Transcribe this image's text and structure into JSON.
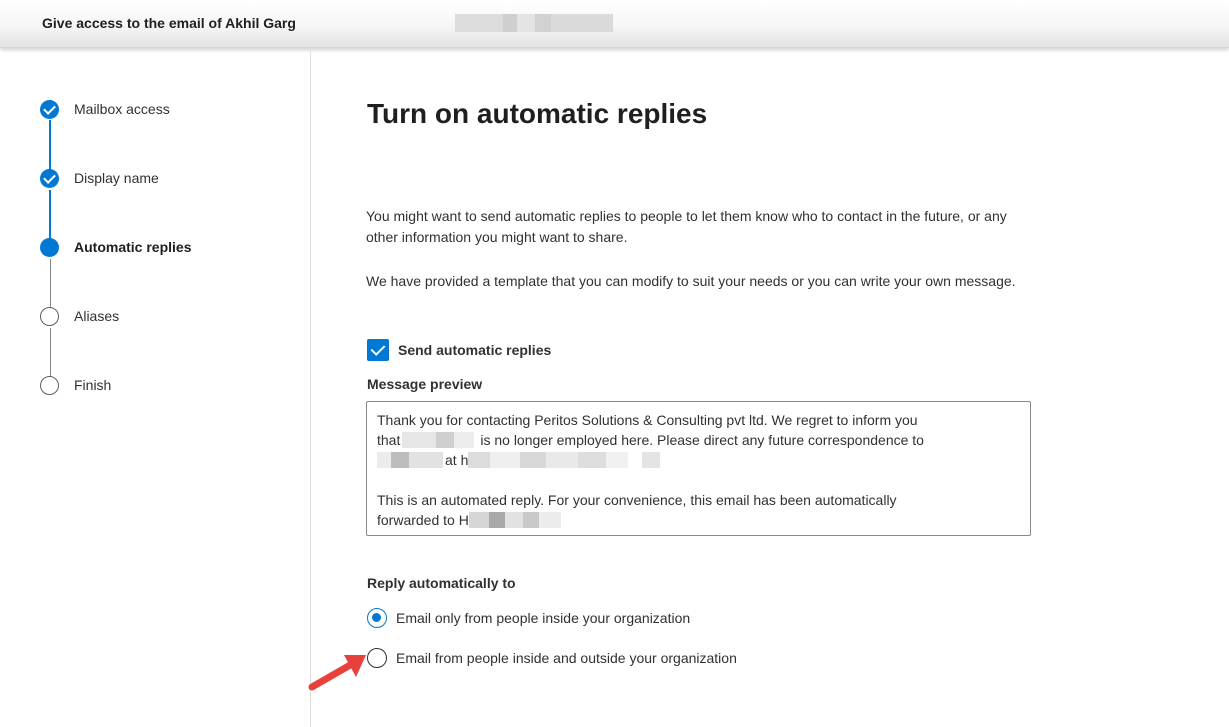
{
  "header": {
    "title": "Give access to the email of Akhil Garg"
  },
  "steps": [
    {
      "label": "Mailbox access",
      "state": "completed"
    },
    {
      "label": "Display name",
      "state": "completed"
    },
    {
      "label": "Automatic replies",
      "state": "current"
    },
    {
      "label": "Aliases",
      "state": "pending"
    },
    {
      "label": "Finish",
      "state": "pending"
    }
  ],
  "main": {
    "title": "Turn on automatic replies",
    "paragraph1": "You might want to send automatic replies to people to let them know who to contact in the future, or any other information you might want to share.",
    "paragraph2": "We have provided a template that you can modify to suit your needs or you can write your own message.",
    "checkbox": {
      "label": "Send automatic replies",
      "checked": true
    },
    "preview": {
      "label": "Message preview",
      "line1": "Thank you for contacting Peritos Solutions & Consulting pvt ltd. We regret to inform you",
      "line2a": "that",
      "line2b": "is no longer employed here. Please direct any future correspondence to",
      "line3a": "at h",
      "line4": " This is an automated reply. For your convenience, this email has been automatically",
      "line5a": "forwarded to H"
    },
    "reply": {
      "label": "Reply automatically to",
      "options": [
        {
          "label": "Email only from people inside your organization",
          "selected": true
        },
        {
          "label": "Email from people inside and outside your organization",
          "selected": false
        }
      ]
    }
  },
  "colors": {
    "accent": "#0078d4",
    "arrow": "#e8413c"
  }
}
